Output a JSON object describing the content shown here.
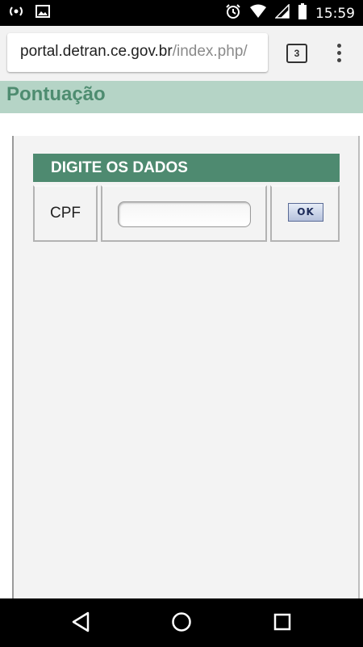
{
  "status_bar": {
    "time": "15:59",
    "icons": [
      "broadcast-icon",
      "image-icon",
      "alarm-icon",
      "wifi-icon",
      "signal-icon",
      "battery-icon"
    ]
  },
  "browser": {
    "url_host": "portal.detran.ce.gov.br",
    "url_path": "/index.php/",
    "tab_count": "3"
  },
  "page": {
    "title": "Pontuação"
  },
  "form": {
    "header": "DIGITE OS DADOS",
    "cpf_label": "CPF",
    "cpf_value": "",
    "cpf_placeholder": "",
    "submit_label": "OK"
  },
  "colors": {
    "header_band": "#b5d4c6",
    "title_text": "#4e8c70",
    "form_header": "#4e8a70"
  },
  "nav_bar": {
    "icons": [
      "back-icon",
      "home-icon",
      "recents-icon"
    ]
  }
}
